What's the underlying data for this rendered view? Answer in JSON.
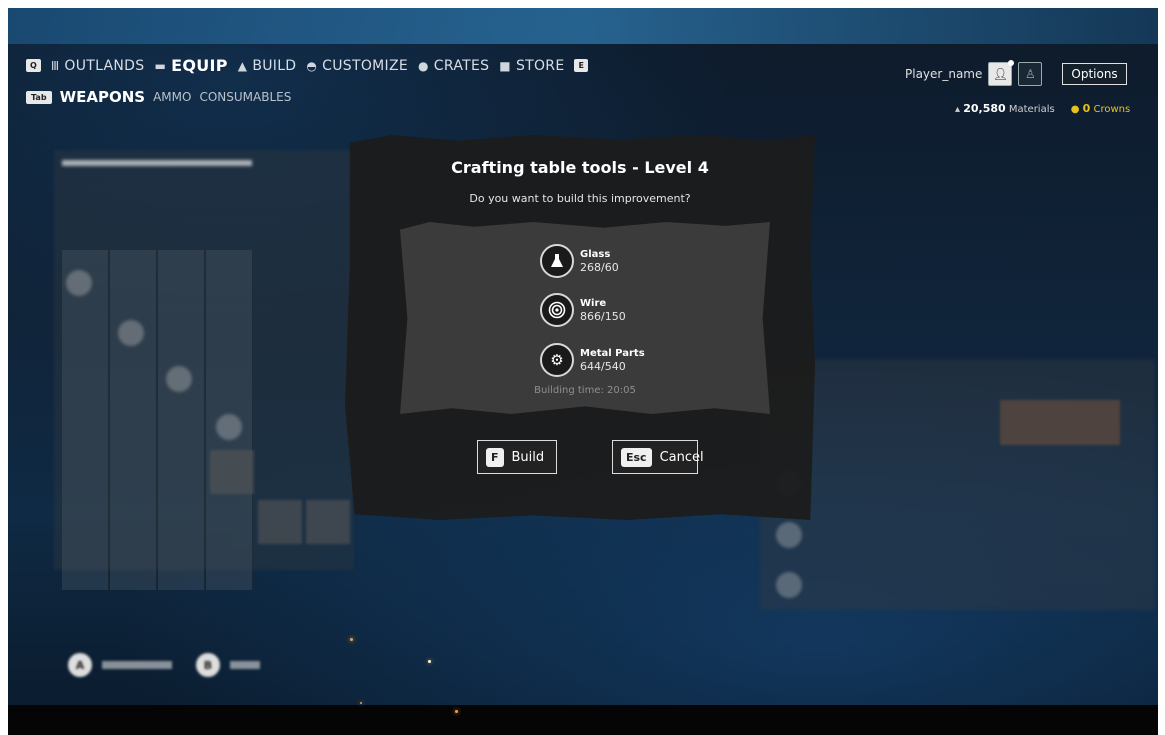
{
  "nav": {
    "q_key": "Q",
    "e_key": "E",
    "items": [
      {
        "label": "OUTLANDS",
        "icon": "outlands-icon",
        "active": false
      },
      {
        "label": "EQUIP",
        "icon": "equip-icon",
        "active": true
      },
      {
        "label": "BUILD",
        "icon": "build-icon",
        "active": false
      },
      {
        "label": "CUSTOMIZE",
        "icon": "customize-icon",
        "active": false
      },
      {
        "label": "CRATES",
        "icon": "crates-icon",
        "active": false
      },
      {
        "label": "STORE",
        "icon": "store-icon",
        "active": false
      }
    ]
  },
  "subnav": {
    "tab_key": "Tab",
    "items": [
      {
        "label": "WEAPONS",
        "active": true
      },
      {
        "label": "AMMO",
        "active": false
      },
      {
        "label": "CONSUMABLES",
        "active": false
      }
    ]
  },
  "user": {
    "name": "Player_name",
    "options_label": "Options"
  },
  "resources": {
    "materials_value": "20,580",
    "materials_label": "Materials",
    "crowns_value": "0",
    "crowns_label": "Crowns"
  },
  "modal": {
    "title": "Crafting table tools - Level 4",
    "question": "Do you want to build this improvement?",
    "materials": [
      {
        "name": "Glass",
        "count": "268/60",
        "icon": "flask-icon"
      },
      {
        "name": "Wire",
        "count": "866/150",
        "icon": "wire-coil-icon"
      },
      {
        "name": "Metal Parts",
        "count": "644/540",
        "icon": "gears-icon"
      }
    ],
    "building_time": "Building time: 20:05",
    "build": {
      "key": "F",
      "label": "Build"
    },
    "cancel": {
      "key": "Esc",
      "label": "Cancel"
    }
  },
  "colors": {
    "crowns": "#e8c21a",
    "modal_bg": "#1c1c1c",
    "inner_bg": "#3b3b3b"
  }
}
